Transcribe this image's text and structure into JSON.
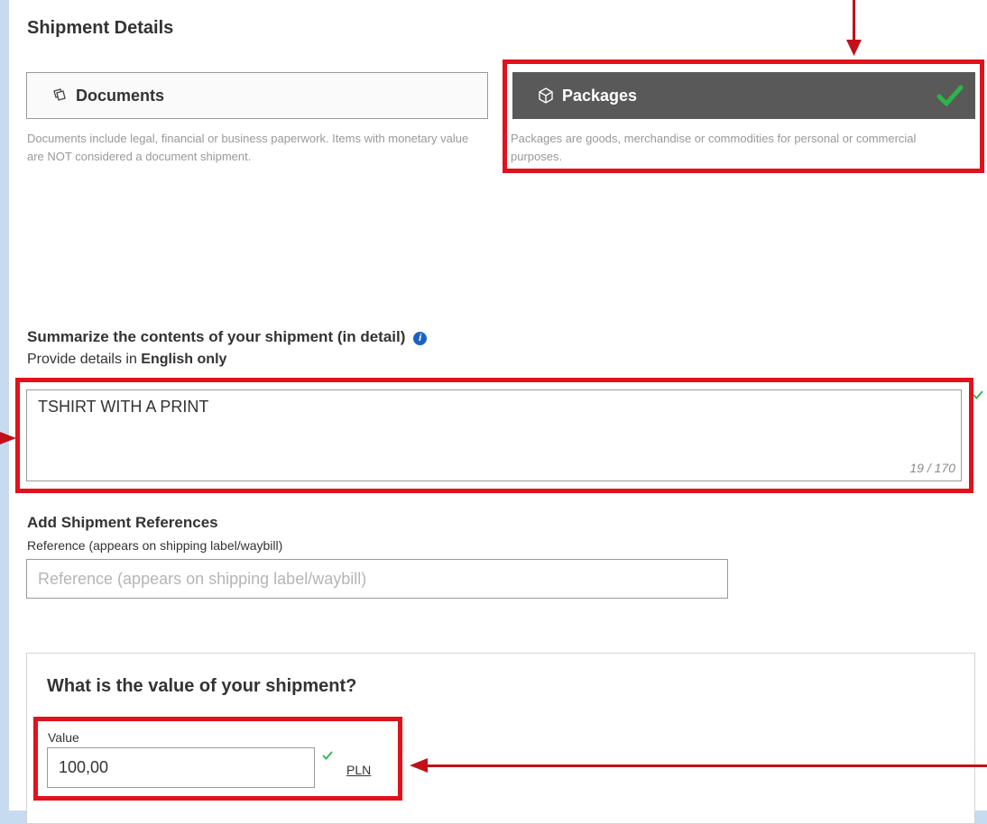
{
  "shipment": {
    "title": "Shipment Details",
    "documents": {
      "label": "Documents",
      "description": "Documents include legal, financial or business paperwork. Items with monetary value are NOT considered a document shipment."
    },
    "packages": {
      "label": "Packages",
      "description": "Packages are goods, merchandise or commodities for personal or commercial purposes.",
      "selected": true
    }
  },
  "summary": {
    "title": "Summarize the contents of your shipment (in detail)",
    "subtitle_prefix": "Provide details in ",
    "subtitle_bold": "English only",
    "value": "TSHIRT WITH A PRINT",
    "counter": "19 / 170"
  },
  "references": {
    "title": "Add Shipment References",
    "label": "Reference (appears on shipping label/waybill)",
    "placeholder": "Reference (appears on shipping label/waybill)"
  },
  "value_section": {
    "title": "What is the value of your shipment?",
    "label": "Value",
    "value": "100,00",
    "currency": "PLN"
  },
  "colors": {
    "highlight": "#e1121c",
    "arrow": "#c4101a",
    "selected_button": "#595959",
    "check": "#2db34a",
    "info": "#1a64c0"
  },
  "icons": [
    "documents-icon",
    "package-icon",
    "check-icon",
    "info-icon"
  ]
}
